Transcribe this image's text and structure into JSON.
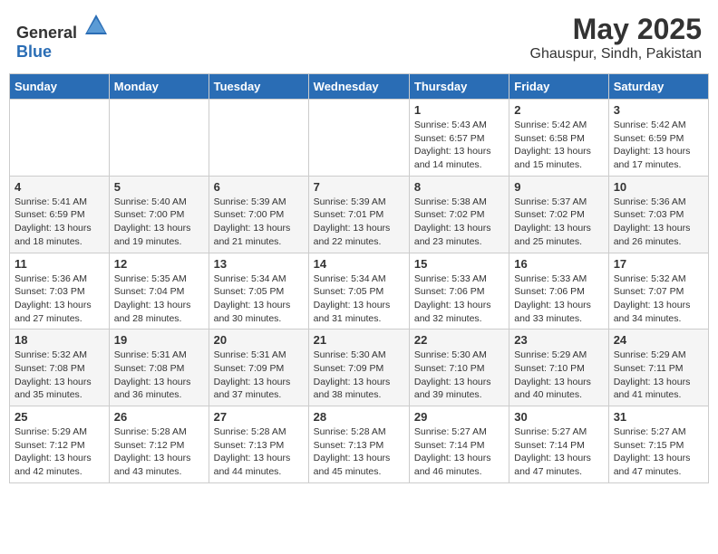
{
  "logo": {
    "text_general": "General",
    "text_blue": "Blue"
  },
  "title": "May 2025",
  "subtitle": "Ghauspur, Sindh, Pakistan",
  "days_of_week": [
    "Sunday",
    "Monday",
    "Tuesday",
    "Wednesday",
    "Thursday",
    "Friday",
    "Saturday"
  ],
  "weeks": [
    [
      {
        "day": "",
        "info": ""
      },
      {
        "day": "",
        "info": ""
      },
      {
        "day": "",
        "info": ""
      },
      {
        "day": "",
        "info": ""
      },
      {
        "day": "1",
        "info": "Sunrise: 5:43 AM\nSunset: 6:57 PM\nDaylight: 13 hours\nand 14 minutes."
      },
      {
        "day": "2",
        "info": "Sunrise: 5:42 AM\nSunset: 6:58 PM\nDaylight: 13 hours\nand 15 minutes."
      },
      {
        "day": "3",
        "info": "Sunrise: 5:42 AM\nSunset: 6:59 PM\nDaylight: 13 hours\nand 17 minutes."
      }
    ],
    [
      {
        "day": "4",
        "info": "Sunrise: 5:41 AM\nSunset: 6:59 PM\nDaylight: 13 hours\nand 18 minutes."
      },
      {
        "day": "5",
        "info": "Sunrise: 5:40 AM\nSunset: 7:00 PM\nDaylight: 13 hours\nand 19 minutes."
      },
      {
        "day": "6",
        "info": "Sunrise: 5:39 AM\nSunset: 7:00 PM\nDaylight: 13 hours\nand 21 minutes."
      },
      {
        "day": "7",
        "info": "Sunrise: 5:39 AM\nSunset: 7:01 PM\nDaylight: 13 hours\nand 22 minutes."
      },
      {
        "day": "8",
        "info": "Sunrise: 5:38 AM\nSunset: 7:02 PM\nDaylight: 13 hours\nand 23 minutes."
      },
      {
        "day": "9",
        "info": "Sunrise: 5:37 AM\nSunset: 7:02 PM\nDaylight: 13 hours\nand 25 minutes."
      },
      {
        "day": "10",
        "info": "Sunrise: 5:36 AM\nSunset: 7:03 PM\nDaylight: 13 hours\nand 26 minutes."
      }
    ],
    [
      {
        "day": "11",
        "info": "Sunrise: 5:36 AM\nSunset: 7:03 PM\nDaylight: 13 hours\nand 27 minutes."
      },
      {
        "day": "12",
        "info": "Sunrise: 5:35 AM\nSunset: 7:04 PM\nDaylight: 13 hours\nand 28 minutes."
      },
      {
        "day": "13",
        "info": "Sunrise: 5:34 AM\nSunset: 7:05 PM\nDaylight: 13 hours\nand 30 minutes."
      },
      {
        "day": "14",
        "info": "Sunrise: 5:34 AM\nSunset: 7:05 PM\nDaylight: 13 hours\nand 31 minutes."
      },
      {
        "day": "15",
        "info": "Sunrise: 5:33 AM\nSunset: 7:06 PM\nDaylight: 13 hours\nand 32 minutes."
      },
      {
        "day": "16",
        "info": "Sunrise: 5:33 AM\nSunset: 7:06 PM\nDaylight: 13 hours\nand 33 minutes."
      },
      {
        "day": "17",
        "info": "Sunrise: 5:32 AM\nSunset: 7:07 PM\nDaylight: 13 hours\nand 34 minutes."
      }
    ],
    [
      {
        "day": "18",
        "info": "Sunrise: 5:32 AM\nSunset: 7:08 PM\nDaylight: 13 hours\nand 35 minutes."
      },
      {
        "day": "19",
        "info": "Sunrise: 5:31 AM\nSunset: 7:08 PM\nDaylight: 13 hours\nand 36 minutes."
      },
      {
        "day": "20",
        "info": "Sunrise: 5:31 AM\nSunset: 7:09 PM\nDaylight: 13 hours\nand 37 minutes."
      },
      {
        "day": "21",
        "info": "Sunrise: 5:30 AM\nSunset: 7:09 PM\nDaylight: 13 hours\nand 38 minutes."
      },
      {
        "day": "22",
        "info": "Sunrise: 5:30 AM\nSunset: 7:10 PM\nDaylight: 13 hours\nand 39 minutes."
      },
      {
        "day": "23",
        "info": "Sunrise: 5:29 AM\nSunset: 7:10 PM\nDaylight: 13 hours\nand 40 minutes."
      },
      {
        "day": "24",
        "info": "Sunrise: 5:29 AM\nSunset: 7:11 PM\nDaylight: 13 hours\nand 41 minutes."
      }
    ],
    [
      {
        "day": "25",
        "info": "Sunrise: 5:29 AM\nSunset: 7:12 PM\nDaylight: 13 hours\nand 42 minutes."
      },
      {
        "day": "26",
        "info": "Sunrise: 5:28 AM\nSunset: 7:12 PM\nDaylight: 13 hours\nand 43 minutes."
      },
      {
        "day": "27",
        "info": "Sunrise: 5:28 AM\nSunset: 7:13 PM\nDaylight: 13 hours\nand 44 minutes."
      },
      {
        "day": "28",
        "info": "Sunrise: 5:28 AM\nSunset: 7:13 PM\nDaylight: 13 hours\nand 45 minutes."
      },
      {
        "day": "29",
        "info": "Sunrise: 5:27 AM\nSunset: 7:14 PM\nDaylight: 13 hours\nand 46 minutes."
      },
      {
        "day": "30",
        "info": "Sunrise: 5:27 AM\nSunset: 7:14 PM\nDaylight: 13 hours\nand 47 minutes."
      },
      {
        "day": "31",
        "info": "Sunrise: 5:27 AM\nSunset: 7:15 PM\nDaylight: 13 hours\nand 47 minutes."
      }
    ]
  ]
}
